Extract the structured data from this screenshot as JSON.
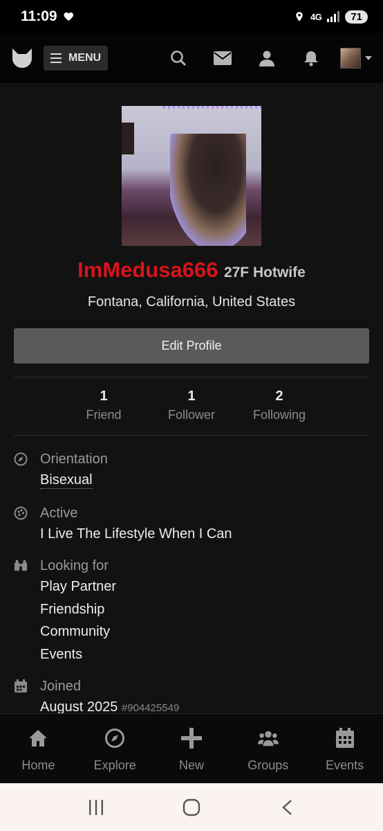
{
  "status_bar": {
    "time": "11:09",
    "network": "4G",
    "battery": "71"
  },
  "top_nav": {
    "menu_label": "MENU"
  },
  "profile": {
    "username": "ImMedusa666",
    "age_sex_role": "27F Hotwife",
    "location": "Fontana, California, United States",
    "edit_button": "Edit Profile"
  },
  "stats": [
    {
      "count": "1",
      "label": "Friend"
    },
    {
      "count": "1",
      "label": "Follower"
    },
    {
      "count": "2",
      "label": "Following"
    }
  ],
  "details": {
    "orientation": {
      "title": "Orientation",
      "value": "Bisexual"
    },
    "active": {
      "title": "Active",
      "value": "I Live The Lifestyle When I Can"
    },
    "looking_for": {
      "title": "Looking for",
      "values": [
        "Play Partner",
        "Friendship",
        "Community",
        "Events"
      ]
    },
    "joined": {
      "title": "Joined",
      "value": "August 2025",
      "member_id": "#904425549"
    }
  },
  "bottom_nav": [
    {
      "label": "Home",
      "icon": "home-icon"
    },
    {
      "label": "Explore",
      "icon": "compass-icon"
    },
    {
      "label": "New",
      "icon": "plus-icon"
    },
    {
      "label": "Groups",
      "icon": "groups-icon"
    },
    {
      "label": "Events",
      "icon": "calendar-icon"
    }
  ],
  "colors": {
    "username": "#d8141a",
    "background": "#121212",
    "button": "#5a5a5a"
  }
}
